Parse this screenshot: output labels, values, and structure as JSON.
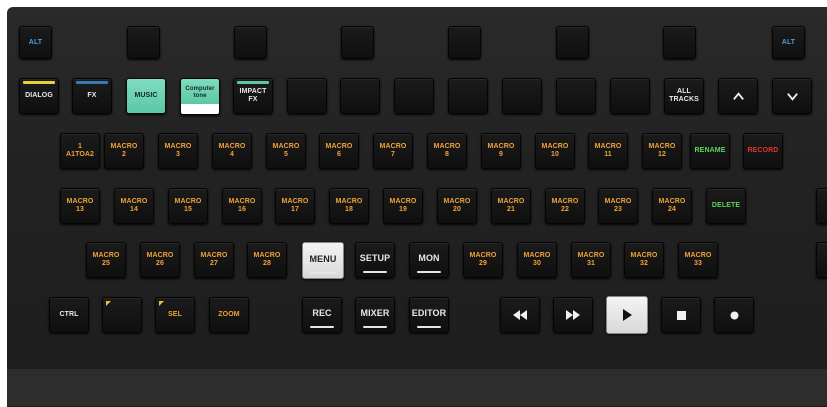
{
  "colors": {
    "panel": "#222222",
    "key": "#131313",
    "label_white": "#e8e8e8",
    "label_orange": "#f0a23a",
    "label_green": "#5cd65c",
    "label_red": "#e0362c",
    "label_blue": "#4a9ee0",
    "dialog_bar": "#e8d23a",
    "fx_bar": "#3a7ab8",
    "impact_bar": "#5cc7a6",
    "music_lit": "#6fd4b5"
  },
  "row1": {
    "alt_left": "ALT",
    "alt_right": "ALT"
  },
  "row2": {
    "dialog": "DIALOG",
    "fx": "FX",
    "music": "MUSIC",
    "computer_tone": "Computer\ntone",
    "impact_fx": "IMPACT\nFX",
    "all_tracks": "ALL\nTRACKS",
    "up_icon": "chevron-up-icon",
    "down_icon": "chevron-down-icon"
  },
  "row3": {
    "a1toa2": "1\nA1TOA2",
    "macros": [
      "MACRO\n2",
      "MACRO\n3",
      "MACRO\n4",
      "MACRO\n5",
      "MACRO\n6",
      "MACRO\n7",
      "MACRO\n8",
      "MACRO\n9",
      "MACRO\n10",
      "MACRO\n11",
      "MACRO\n12"
    ],
    "rename": "RENAME",
    "record": "RECORD"
  },
  "row4": {
    "macros": [
      "MACRO\n13",
      "MACRO\n14",
      "MACRO\n15",
      "MACRO\n16",
      "MACRO\n17",
      "MACRO\n18",
      "MACRO\n19",
      "MACRO\n20",
      "MACRO\n21",
      "MACRO\n22",
      "MACRO\n23",
      "MACRO\n24"
    ],
    "delete": "DELETE"
  },
  "row5": {
    "macros_left": [
      "MACRO\n25",
      "MACRO\n26",
      "MACRO\n27",
      "MACRO\n28"
    ],
    "menu": "MENU",
    "setup": "SETUP",
    "mon": "MON",
    "macros_right": [
      "MACRO\n29",
      "MACRO\n30",
      "MACRO\n31",
      "MACRO\n32",
      "MACRO\n33"
    ]
  },
  "row6": {
    "ctrl": "CTRL",
    "sel": "SEL",
    "zoom": "ZOOM",
    "rec": "REC",
    "mixer": "MIXER",
    "editor": "EDITOR",
    "rewind_icon": "rewind-icon",
    "fast_forward_icon": "fast-forward-icon",
    "play_icon": "play-icon",
    "stop_icon": "stop-icon",
    "record_icon": "record-dot-icon"
  }
}
